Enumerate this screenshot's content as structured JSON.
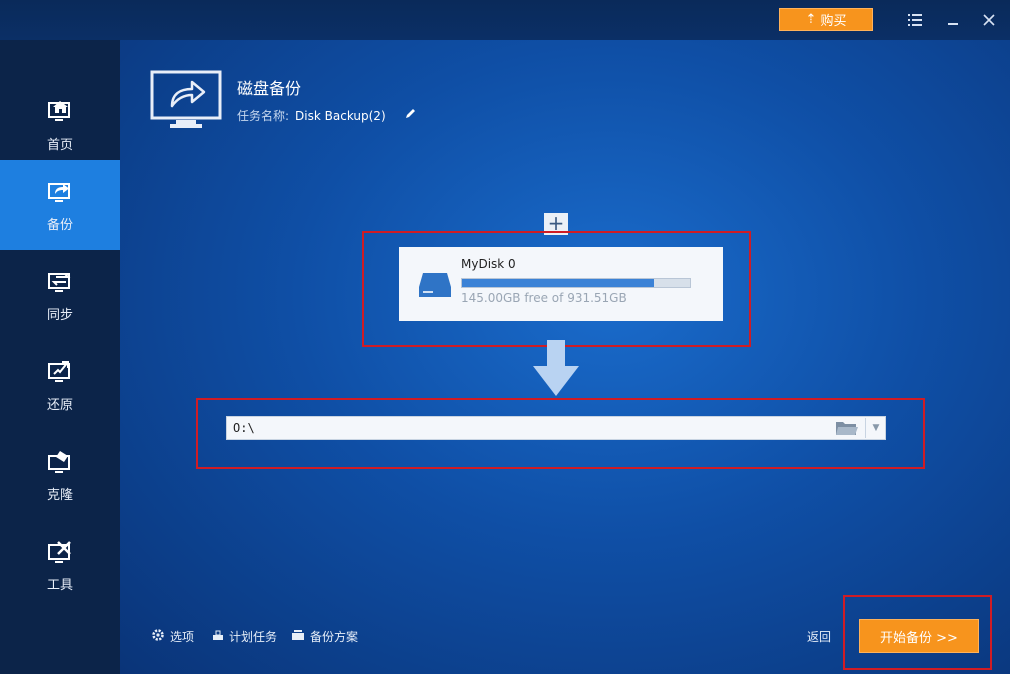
{
  "titlebar": {
    "buy_label": "购买",
    "menu_icon": "hamburger-menu-icon",
    "minimize_icon": "minimize-icon",
    "close_icon": "close-icon"
  },
  "sidebar": {
    "items": [
      {
        "label": "首页",
        "icon": "home-monitor-icon"
      },
      {
        "label": "备份",
        "icon": "backup-monitor-icon",
        "active": true
      },
      {
        "label": "同步",
        "icon": "sync-monitor-icon"
      },
      {
        "label": "还原",
        "icon": "restore-monitor-icon"
      },
      {
        "label": "克隆",
        "icon": "clone-monitor-icon"
      },
      {
        "label": "工具",
        "icon": "tools-monitor-icon"
      }
    ]
  },
  "header": {
    "title": "磁盘备份",
    "task_name_label": "任务名称:",
    "task_name_value": "Disk Backup(2)"
  },
  "source": {
    "disk_name": "MyDisk 0",
    "free_text": "145.00GB free of 931.51GB",
    "used_fraction": 0.844
  },
  "destination": {
    "path": "O:\\"
  },
  "footer": {
    "options_label": "选项",
    "schedule_label": "计划任务",
    "scheme_label": "备份方案",
    "back_label": "返回",
    "start_label": "开始备份 >>"
  },
  "colors": {
    "accent_orange": "#f7941d",
    "sidebar_active": "#1e7fe0",
    "highlight_red": "#d01c24"
  }
}
